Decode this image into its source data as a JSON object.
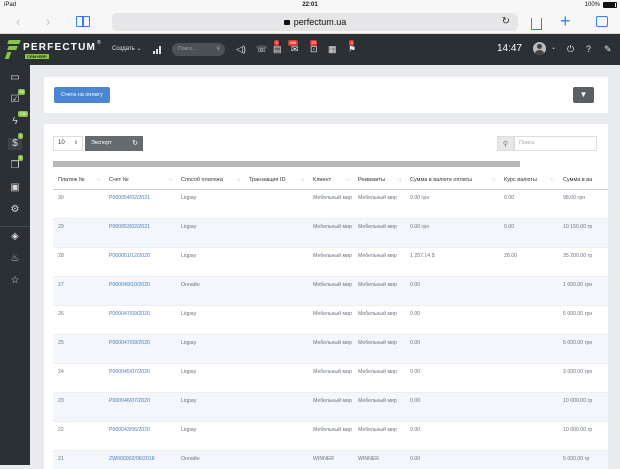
{
  "status": {
    "device": "iPad",
    "time": "22:01",
    "battery": "100%"
  },
  "browser": {
    "url": "perfectum.ua",
    "back": "‹",
    "forward": "›",
    "reload": "↻"
  },
  "app": {
    "brand": "PERFECTUM",
    "brand_sub": "CRM+ERP",
    "reg": "®",
    "create_label": "Создать",
    "create_arrow": "⌄",
    "search_placeholder": "Поиск...",
    "clock": "14:47",
    "badges": {
      "tasks": "3",
      "mail": "466",
      "inbox": "29",
      "alerts": "4"
    },
    "sidebar_badges": {
      "checks": "56",
      "flash": "236",
      "money": "4",
      "docs": "3"
    }
  },
  "toolbar": {
    "invoice_button": "Счета на оплату",
    "filter_icon": "▼"
  },
  "table_controls": {
    "per_page": "10",
    "export_label": "Экспорт",
    "search_placeholder": "Поиск"
  },
  "columns": [
    "Платеж №",
    "Счет №",
    "Способ платежа",
    "Транзакция ID",
    "Клиент",
    "Реквизиты",
    "Сумма в валюте оплаты",
    "Курс валюты",
    "Сумма в ва"
  ],
  "rows": [
    {
      "num": "30",
      "invoice": "P000054/02/2021",
      "method": "Liqpay",
      "tx": "",
      "client": "Мебельный мир",
      "details": "Мебельный мир",
      "sum_cur": "0.00 грн",
      "rate": "0.00",
      "sum": "98.00 грн"
    },
    {
      "num": "29",
      "invoice": "P000053/02/2021",
      "method": "Liqpay",
      "tx": "",
      "client": "Мебельный мир",
      "details": "Мебельный мир",
      "sum_cur": "0.00 грн",
      "rate": "0.00",
      "sum": "10 150.00 гр"
    },
    {
      "num": "28",
      "invoice": "P000051/12/2020",
      "method": "Liqpay",
      "tx": "",
      "client": "Мебельный мир",
      "details": "Мебельный мир",
      "sum_cur": "1 257.14 $",
      "rate": "28.00",
      "sum": "35 200.00 гр"
    },
    {
      "num": "27",
      "invoice": "P000049/10/2020",
      "method": "Онлайн",
      "tx": "",
      "client": "Мебельный мир",
      "details": "Мебельный мир",
      "sum_cur": "0.00",
      "rate": "",
      "sum": "1 000.00 грн"
    },
    {
      "num": "26",
      "invoice": "P000047/09/2020",
      "method": "Liqpay",
      "tx": "",
      "client": "Мебельный мир",
      "details": "Мебельный мир",
      "sum_cur": "0.00",
      "rate": "",
      "sum": "5 000.00 грн"
    },
    {
      "num": "25",
      "invoice": "P000047/09/2020",
      "method": "Liqpay",
      "tx": "",
      "client": "Мебельный мир",
      "details": "Мебельный мир",
      "sum_cur": "0.00",
      "rate": "",
      "sum": "5 000.00 грн"
    },
    {
      "num": "24",
      "invoice": "P000045/07/2020",
      "method": "Liqpay",
      "tx": "",
      "client": "Мебельный мир",
      "details": "Мебельный мир",
      "sum_cur": "0.00",
      "rate": "",
      "sum": "3 000.00 грн"
    },
    {
      "num": "23",
      "invoice": "P000046/07/2020",
      "method": "Liqpay",
      "tx": "",
      "client": "Мебельный мир",
      "details": "Мебельный мир",
      "sum_cur": "0.00",
      "rate": "",
      "sum": "10 000.00 гр"
    },
    {
      "num": "22",
      "invoice": "P000043/06/2020",
      "method": "Liqpay",
      "tx": "",
      "client": "Мебельный мир",
      "details": "Мебельный мир",
      "sum_cur": "0.00",
      "rate": "",
      "sum": "10 000.00 гр"
    },
    {
      "num": "21",
      "invoice": "ZW000002/06/2018",
      "method": "Онлайн",
      "tx": "",
      "client": "WINNER",
      "details": "WINNER",
      "sum_cur": "0.00",
      "rate": "",
      "sum": "5 000.00 гр"
    }
  ]
}
